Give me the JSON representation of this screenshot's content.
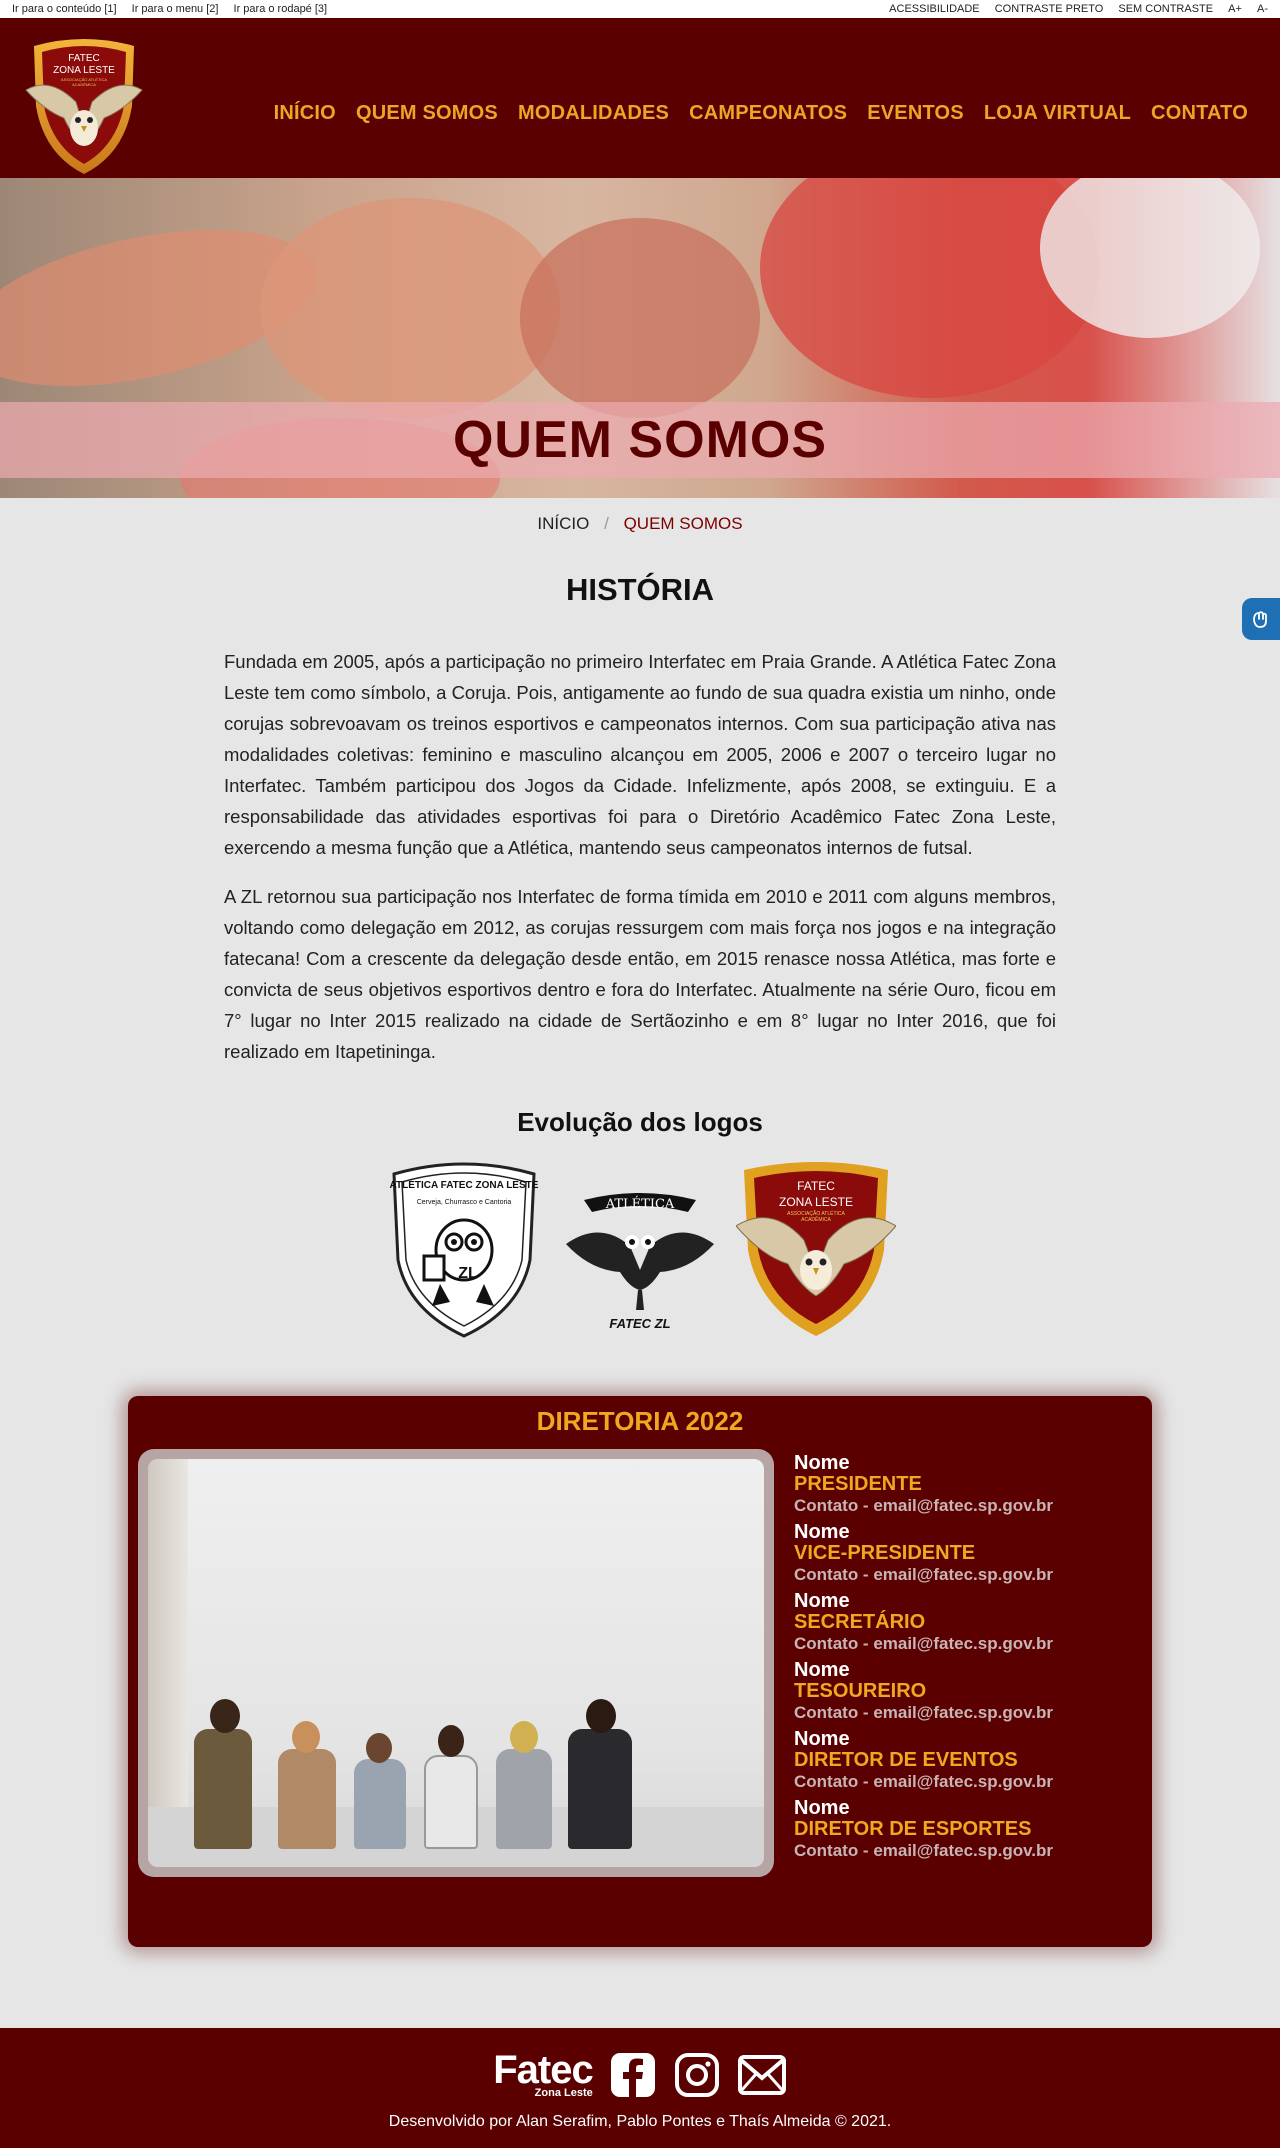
{
  "accessibility_bar": {
    "skip_links": [
      "Ir para o conteúdo [1]",
      "Ir para o menu [2]",
      "Ir para o rodapé [3]"
    ],
    "options": [
      "ACESSIBILIDADE",
      "CONTRASTE PRETO",
      "SEM CONTRASTE",
      "A+",
      "A-"
    ]
  },
  "logo": {
    "line1": "FATEC",
    "line2": "ZONA LESTE",
    "line3": "ASSOCIAÇÃO ATLÉTICA",
    "line4": "ACADÊMICA"
  },
  "nav": {
    "items": [
      "INÍCIO",
      "QUEM SOMOS",
      "MODALIDADES",
      "CAMPEONATOS",
      "EVENTOS",
      "LOJA VIRTUAL",
      "CONTATO"
    ]
  },
  "hero": {
    "title": "QUEM SOMOS"
  },
  "breadcrumb": {
    "home": "INÍCIO",
    "separator": "/",
    "current": "QUEM SOMOS"
  },
  "history": {
    "title": "HISTÓRIA",
    "paragraphs": [
      "Fundada em 2005, após a participação no primeiro Interfatec em Praia Grande. A Atlética Fatec Zona Leste tem como símbolo, a Coruja. Pois, antigamente ao fundo de sua quadra existia um ninho, onde corujas sobrevoavam os treinos esportivos e campeonatos internos. Com sua participação ativa nas modalidades coletivas: feminino e masculino alcançou em 2005, 2006 e 2007 o terceiro lugar no Interfatec. Também participou dos Jogos da Cidade. Infelizmente, após 2008, se extinguiu. E a responsabilidade das atividades esportivas foi para o Diretório Acadêmico Fatec Zona Leste, exercendo a mesma função que a Atlética, mantendo seus campeonatos internos de futsal.",
      "A ZL retornou sua participação nos Interfatec de forma tímida em 2010 e 2011 com alguns membros, voltando como delegação em 2012, as corujas ressurgem com mais força nos jogos e na integração fatecana! Com a crescente da delegação desde então, em 2015 renasce nossa Atlética, mas forte e convicta de seus objetivos esportivos dentro e fora do Interfatec. Atualmente na série Ouro, ficou em 7° lugar no Inter 2015 realizado na cidade de Sertãozinho e em 8° lugar no Inter 2016, que foi realizado em Itapetininga."
    ]
  },
  "logos": {
    "title": "Evolução dos logos",
    "old_logo_text": "ATLÉTICA FATEC ZONA LESTE",
    "old_logo_sub": "Cerveja, Churrasco e Cantoria",
    "old_logo_mark": "ZL",
    "mid_logo_banner": "ATLÉTICA",
    "mid_logo_caption": "FATEC ZL"
  },
  "board": {
    "title": "DIRETORIA 2022",
    "members": [
      {
        "name": "Nome",
        "role": "PRESIDENTE",
        "contact": "Contato - email@fatec.sp.gov.br"
      },
      {
        "name": "Nome",
        "role": "VICE-PRESIDENTE",
        "contact": "Contato - email@fatec.sp.gov.br"
      },
      {
        "name": "Nome",
        "role": "SECRETÁRIO",
        "contact": "Contato - email@fatec.sp.gov.br"
      },
      {
        "name": "Nome",
        "role": "TESOUREIRO",
        "contact": "Contato - email@fatec.sp.gov.br"
      },
      {
        "name": "Nome",
        "role": "DIRETOR DE EVENTOS",
        "contact": "Contato - email@fatec.sp.gov.br"
      },
      {
        "name": "Nome",
        "role": "DIRETOR DE ESPORTES",
        "contact": "Contato - email@fatec.sp.gov.br"
      }
    ]
  },
  "footer": {
    "brand_name": "Fatec",
    "brand_sub": "Zona Leste",
    "social_icons": [
      "facebook-icon",
      "instagram-icon",
      "email-icon"
    ],
    "credit": "Desenvolvido por Alan Serafim, Pablo Pontes e Thaís Almeida © 2021."
  },
  "colors": {
    "brand_dark_red": "#5a0000",
    "accent_gold": "#e8a724",
    "page_bg": "#e6e6e6"
  }
}
